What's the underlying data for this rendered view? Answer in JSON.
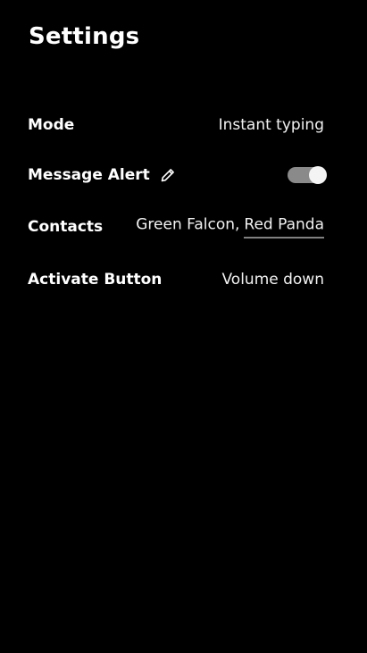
{
  "header": {
    "title": "Settings"
  },
  "settings": {
    "mode": {
      "label": "Mode",
      "value": "Instant typing"
    },
    "message_alert": {
      "label": "Message Alert",
      "edit_icon": "pencil-icon",
      "enabled": true
    },
    "contacts": {
      "label": "Contacts",
      "first": "Green Falcon,",
      "second": "Red Panda"
    },
    "activate_button": {
      "label": "Activate Button",
      "value": "Volume down"
    }
  },
  "colors": {
    "background": "#000000",
    "text": "#ffffff",
    "toggle_track": "#8a8a8a",
    "toggle_knob": "#f4f4f4"
  }
}
